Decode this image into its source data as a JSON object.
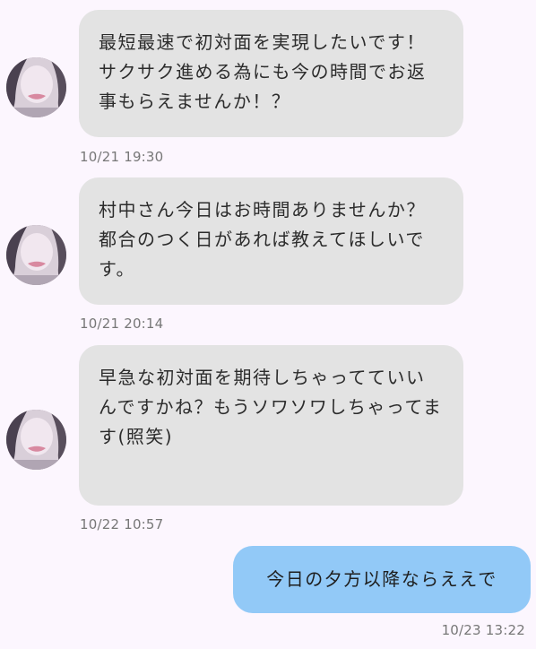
{
  "colors": {
    "background": "#FCF6FE",
    "incoming_bubble": "#E3E3E3",
    "outgoing_bubble": "#92C9F7",
    "timestamp": "#777777"
  },
  "messages": [
    {
      "direction": "incoming",
      "avatar_icon": "profile-avatar",
      "text": "最短最速で初対面を実現したいです！サクサク進める為にも今の時間でお返事もらえませんか！？",
      "time": "10/21 19:30"
    },
    {
      "direction": "incoming",
      "avatar_icon": "profile-avatar",
      "text": "村中さん今日はお時間ありませんか？都合のつく日があれば教えてほしいです。",
      "time": "10/21 20:14"
    },
    {
      "direction": "incoming",
      "avatar_icon": "profile-avatar",
      "text": "早急な初対面を期待しちゃってていいんですかね？もうソワソワしちゃってます(照笑)",
      "time": "10/22 10:57"
    },
    {
      "direction": "outgoing",
      "text": "今日の夕方以降ならええで",
      "time": "10/23 13:22"
    }
  ]
}
